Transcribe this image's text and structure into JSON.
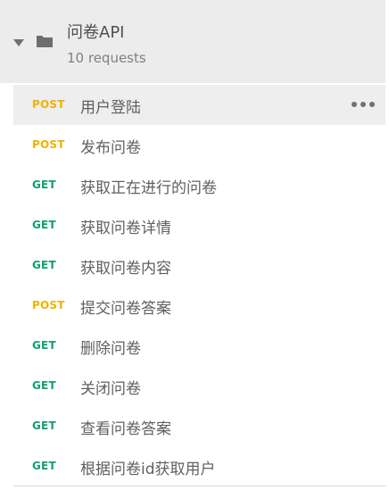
{
  "collection": {
    "name": "问卷API",
    "count": "10 requests"
  },
  "requests": [
    {
      "method": "POST",
      "name": "用户登陆"
    },
    {
      "method": "POST",
      "name": "发布问卷"
    },
    {
      "method": "GET",
      "name": "获取正在进行的问卷"
    },
    {
      "method": "GET",
      "name": "获取问卷详情"
    },
    {
      "method": "GET",
      "name": "获取问卷内容"
    },
    {
      "method": "POST",
      "name": "提交问卷答案"
    },
    {
      "method": "GET",
      "name": "删除问卷"
    },
    {
      "method": "GET",
      "name": "关闭问卷"
    },
    {
      "method": "GET",
      "name": "查看问卷答案"
    },
    {
      "method": "GET",
      "name": "根据问卷id获取用户"
    }
  ],
  "colors": {
    "post": "#f0b100",
    "get": "#10a070",
    "header_bg": "#ececec"
  },
  "icons": {
    "toggle": "caret-down-icon",
    "folder": "folder-icon",
    "more": "more-horizontal-icon"
  }
}
